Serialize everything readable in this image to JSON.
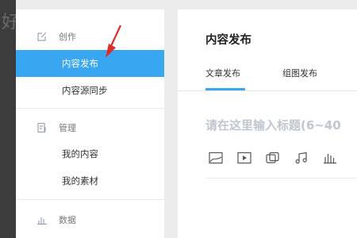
{
  "background_glyph": "好",
  "sidebar": {
    "sections": [
      {
        "label": "创作",
        "icon": "edit-icon"
      },
      {
        "label": "管理",
        "icon": "document-icon"
      },
      {
        "label": "数据",
        "icon": "bar-chart-icon"
      }
    ],
    "items": [
      {
        "label": "内容发布",
        "active": true
      },
      {
        "label": "内容源同步",
        "active": false
      },
      {
        "label": "我的内容",
        "active": false
      },
      {
        "label": "我的素材",
        "active": false
      }
    ]
  },
  "main": {
    "title": "内容发布",
    "tabs": [
      {
        "label": "文章发布",
        "active": true
      },
      {
        "label": "组图发布",
        "active": false
      }
    ],
    "title_placeholder": "请在这里输入标题(6~40",
    "toolbar": [
      "image-icon",
      "video-icon",
      "gallery-icon",
      "music-icon",
      "chart-icon"
    ]
  },
  "colors": {
    "accent": "#38a6f0",
    "annotation_arrow": "#e02b2b"
  }
}
